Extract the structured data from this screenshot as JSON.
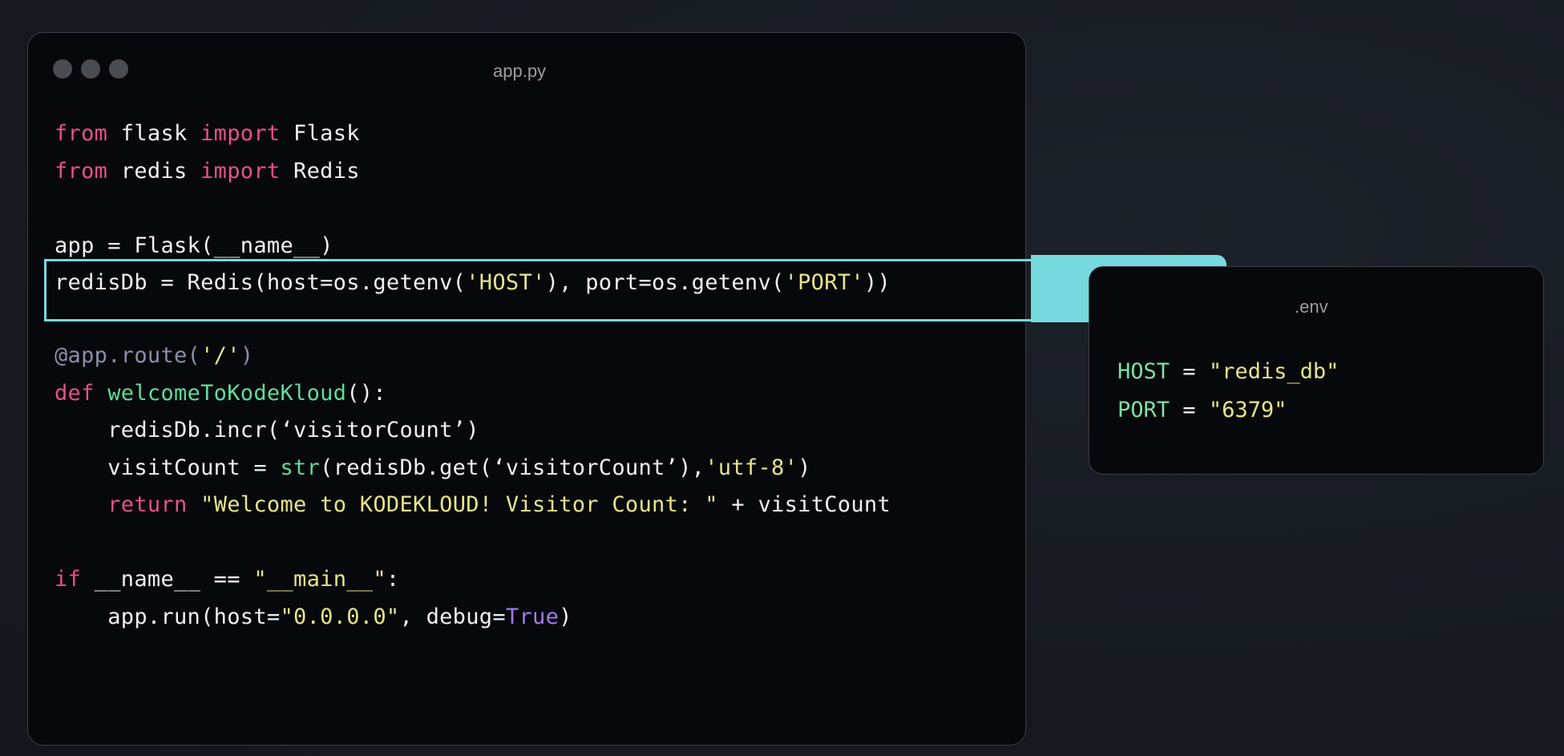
{
  "main_window": {
    "title": "app.py"
  },
  "env_window": {
    "title": ".env",
    "lines": [
      {
        "key": "HOST",
        "op": " = ",
        "value": "\"redis_db\""
      },
      {
        "key": "PORT",
        "op": " = ",
        "value": "\"6379\""
      }
    ]
  },
  "code": {
    "l1": {
      "kw1": "from",
      "t1": " flask ",
      "kw2": "import",
      "t2": " Flask"
    },
    "l2": {
      "kw1": "from",
      "t1": " redis ",
      "kw2": "import",
      "t2": " Redis"
    },
    "l4": {
      "t1": "app = Flask(__name__)"
    },
    "l5": {
      "t1": "redisDb = Redis(host=os.getenv(",
      "s1": "'HOST'",
      "t2": "), port=os.getenv(",
      "s2": "'PORT'",
      "t3": "))"
    },
    "l7": {
      "dec": "@app.route(",
      "s1": "'/'",
      "dec2": ")"
    },
    "l8": {
      "kw": "def",
      "sp": " ",
      "fn": "welcomeToKodeKloud",
      "t1": "():"
    },
    "l9": {
      "t1": "    redisDb.incr(‘visitorCount’)"
    },
    "l10": {
      "t1": "    visitCount = ",
      "fn": "str",
      "t2": "(redisDb.get(‘visitorCount’),",
      "s1": "'utf-8'",
      "t3": ")"
    },
    "l11": {
      "ind": "    ",
      "kw": "return",
      "sp": " ",
      "s1": "\"Welcome to KODEKLOUD! Visitor Count: \"",
      "t1": " + visitCount"
    },
    "l13": {
      "kw": "if",
      "t1": " __name__ == ",
      "s1": "\"__main__\"",
      "t2": ":"
    },
    "l14": {
      "t1": "    app.run(host=",
      "s1": "\"0.0.0.0\"",
      "t2": ", debug=",
      "b1": "True",
      "t3": ")"
    }
  },
  "colors": {
    "keyword": "#e8508c",
    "function": "#5fdc9a",
    "string": "#e6e48a",
    "decorator": "#8a8fa8",
    "boolean": "#9d7cf0",
    "highlight": "#76d9dd",
    "window_bg": "#07080b"
  },
  "icons": [
    "traffic-light-close-icon",
    "traffic-light-minimize-icon",
    "traffic-light-maximize-icon"
  ]
}
